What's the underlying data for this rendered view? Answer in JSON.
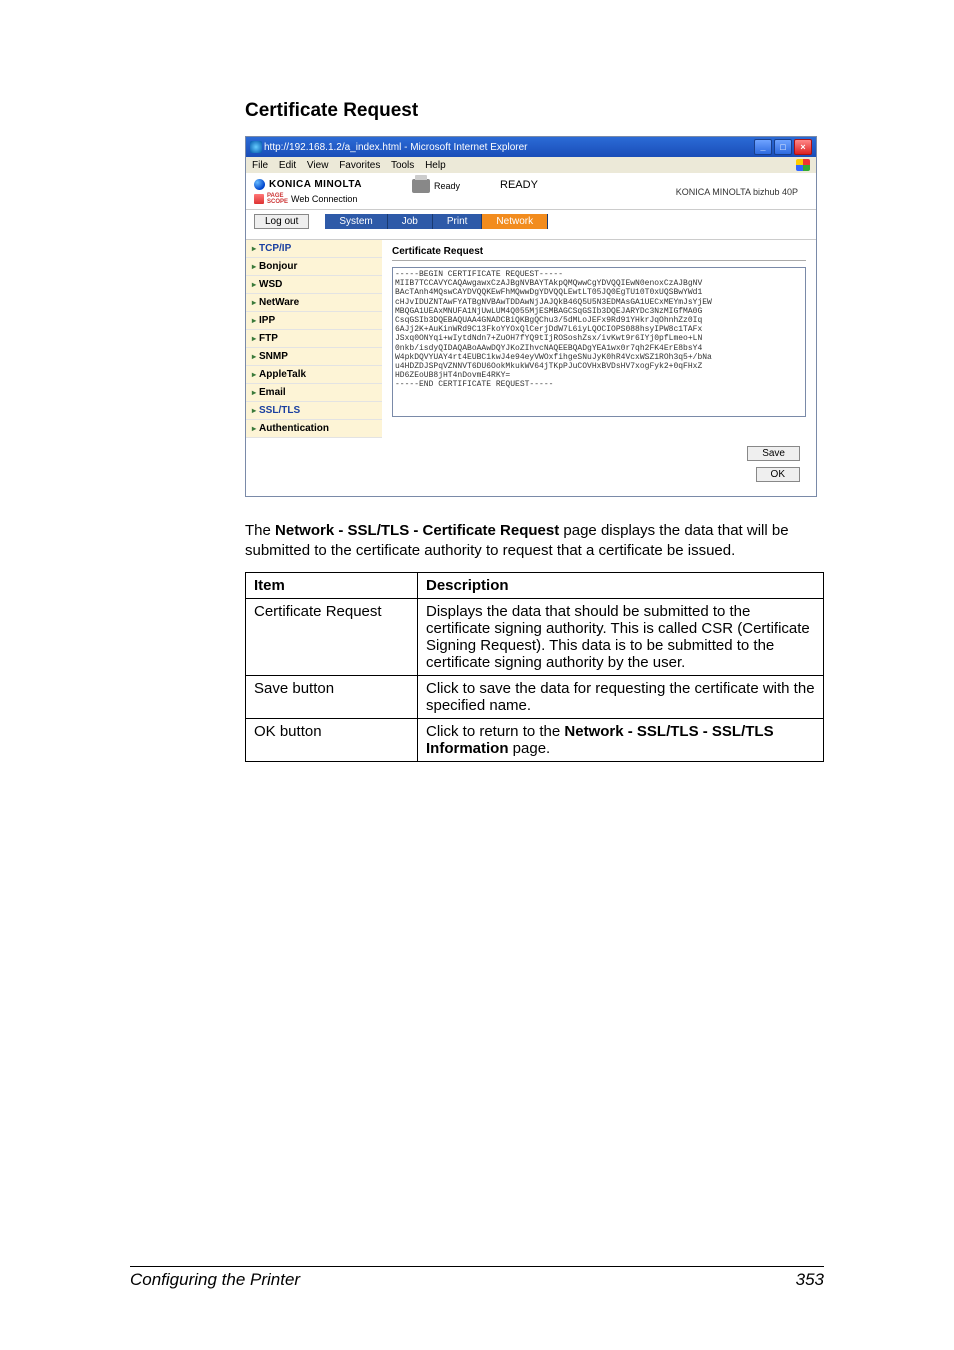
{
  "heading": "Certificate Request",
  "browser": {
    "title": "http://192.168.1.2/a_index.html - Microsoft Internet Explorer",
    "menu": {
      "file": "File",
      "edit": "Edit",
      "view": "View",
      "favorites": "Favorites",
      "tools": "Tools",
      "help": "Help"
    }
  },
  "header": {
    "brand": "KONICA MINOLTA",
    "pagescope": "Web Connection",
    "ps_prefix": "PAGE\nSCOPE",
    "status_small": "Ready",
    "status_big": "READY",
    "model": "KONICA MINOLTA bizhub 40P"
  },
  "logout": "Log out",
  "tabs": {
    "system": "System",
    "job": "Job",
    "print": "Print",
    "network": "Network"
  },
  "sidebar": {
    "tcpip": "TCP/IP",
    "bonjour": "Bonjour",
    "wsd": "WSD",
    "netware": "NetWare",
    "ipp": "IPP",
    "ftp": "FTP",
    "snmp": "SNMP",
    "appletalk": "AppleTalk",
    "email": "Email",
    "ssltls": "SSL/TLS",
    "auth": "Authentication"
  },
  "panel": {
    "title": "Certificate Request",
    "csr": "-----BEGIN CERTIFICATE REQUEST-----\nMIIB7TCCAVYCAQAwgawxCzAJBgNVBAYTAkpQMQwwCgYDVQQIEwN0enoxCzAJBgNV\nBAcTAnh4MQswCAYDVQQKEwFhMQwwDgYDVQQLEwtLT05JQ0EgTU10T0xUQSBwYWd1\ncHJvIDUZNTAwFYATBgNVBAwTDDAwNjJAJQkB46Q5U5N3EDMAsGA1UECxMEYmJsYjEW\nMBQGA1UEAxMNUFA1NjUwLUM4Q055MjESMBAGCSqGSIb3DQEJARYDc3NzMIGfMA0G\nCsqGSIb3DQEBAQUAA4GNADCBiQKBgQChu3/5dMLoJEFx9Rd91YHkrJqOhnhZz0Iq\n6AJj2K+AuKinWRd9C13FkoYYOxQlCerjDdW7L6iyLQOCIOPS088hsyIPW8c1TAFx\nJSxq0ONYqi+wIytdNdn7+ZuOH7fYQ9tIjROSoshZsx/ivKwt9r6IYj0pfLmeo+LN\n0nkb/isdyQIDAQABoAAwDQYJKoZIhvcNAQEEBQADgYEA1wx0r7qh2FK4ErE8bsY4\nW4pkDQVYUAY4rt4EUBC1kwJ4e94eyVWOxfihgeSNuJyK0hR4VcxWSZ1ROh3q5+/bNa\nu4HDZDJSPqVZNNVT6DU6OokMkukWV64jTKpPJuCOVHxBVDsHV7xogFyk2+0qFHxZ\nHD6ZEoUB8jHT4nDovmE4RKY=\n-----END CERTIFICATE REQUEST-----"
  },
  "buttons": {
    "save": "Save",
    "ok": "OK"
  },
  "body_paragraph": {
    "pre": "The ",
    "bold": "Network - SSL/TLS - Certificate Request",
    "post": " page displays the data that will be submitted to the certificate authority to request that a certificate be issued."
  },
  "table": {
    "head": {
      "item": "Item",
      "desc": "Description"
    },
    "rows": [
      {
        "item": "Certificate Request",
        "desc": "Displays the data that should be submitted to the certificate signing authority. This is called CSR (Certificate Signing Request). This data is to be submitted to the certificate signing authority by the user."
      },
      {
        "item": "Save button",
        "desc": "Click to save the data for requesting the certificate with the specified name."
      },
      {
        "item": "OK button",
        "desc_pre": "Click to return to the ",
        "desc_bold": "Network - SSL/TLS - SSL/TLS Information",
        "desc_post": " page."
      }
    ]
  },
  "footer": {
    "left": "Configuring the Printer",
    "right": "353"
  }
}
